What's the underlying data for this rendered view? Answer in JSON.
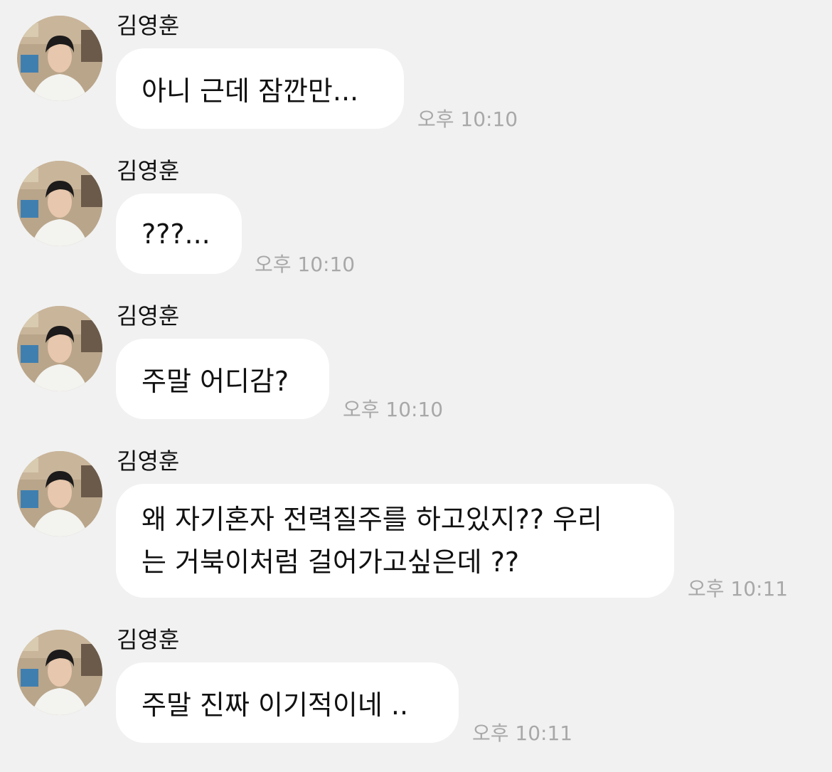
{
  "messages": [
    {
      "sender": "김영훈",
      "text": "아니 근데 잠깐만...",
      "time": "오후 10:10"
    },
    {
      "sender": "김영훈",
      "text": "???...",
      "time": "오후 10:10"
    },
    {
      "sender": "김영훈",
      "text": "주말 어디감?",
      "time": "오후 10:10"
    },
    {
      "sender": "김영훈",
      "lines": [
        "왜 자기혼자 전력질주를 하고있지?? 우리",
        "는 거북이처럼 걸어가고싶은데 ??"
      ],
      "time": "오후 10:11"
    },
    {
      "sender": "김영훈",
      "text": "주말 진짜 이기적이네 ..",
      "time": "오후 10:11"
    }
  ],
  "colors": {
    "background": "#f1f1f1",
    "bubble": "#ffffff",
    "timestamp": "#a8a8a8"
  },
  "icons": {
    "avatar": "profile-photo"
  }
}
